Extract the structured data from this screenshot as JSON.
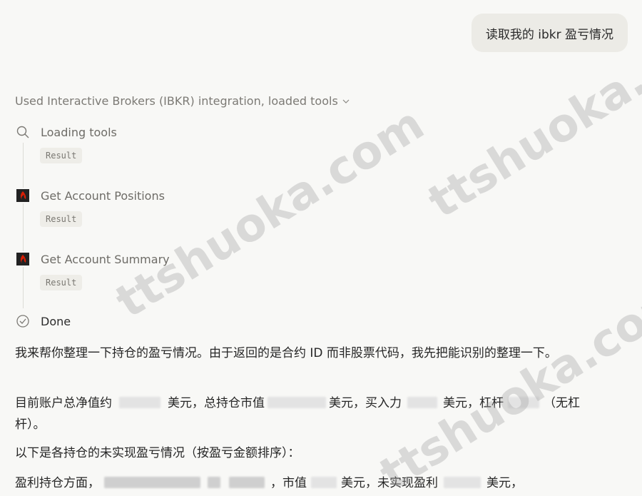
{
  "user_message": "读取我的 ibkr 盈亏情况",
  "tool_header": {
    "label": "Used Interactive Brokers (IBKR) integration, loaded tools"
  },
  "steps": [
    {
      "label": "Loading tools",
      "icon": "search-icon",
      "result": "Result"
    },
    {
      "label": "Get Account Positions",
      "icon": "ibkr-logo-icon",
      "result": "Result"
    },
    {
      "label": "Get Account Summary",
      "icon": "ibkr-logo-icon",
      "result": "Result"
    },
    {
      "label": "Done",
      "icon": "check-circle-icon"
    }
  ],
  "response": {
    "p1": "我来帮你整理一下持仓的盈亏情况。由于返回的是合约 ID 而非股票代码，我先把能识别的整理一下。",
    "p2a": "目前账户总净值约",
    "p2b": "美元，总持仓市值",
    "p2c": "美元，买入力",
    "p2d": "美元，杠杆",
    "p2e": "（无杠杆）。",
    "p3": "以下是各持仓的未实现盈亏情况（按盈亏金额排序）：",
    "p4a": "盈利持仓方面，",
    "p4b": "，市值",
    "p4c": "美元，未实现盈利",
    "p4d": "美元，"
  },
  "watermark": "ttshuoka.com",
  "colors": {
    "background": "#f8f8f6",
    "bubble": "#ecebe6",
    "ibkr_red": "#d81e05"
  }
}
